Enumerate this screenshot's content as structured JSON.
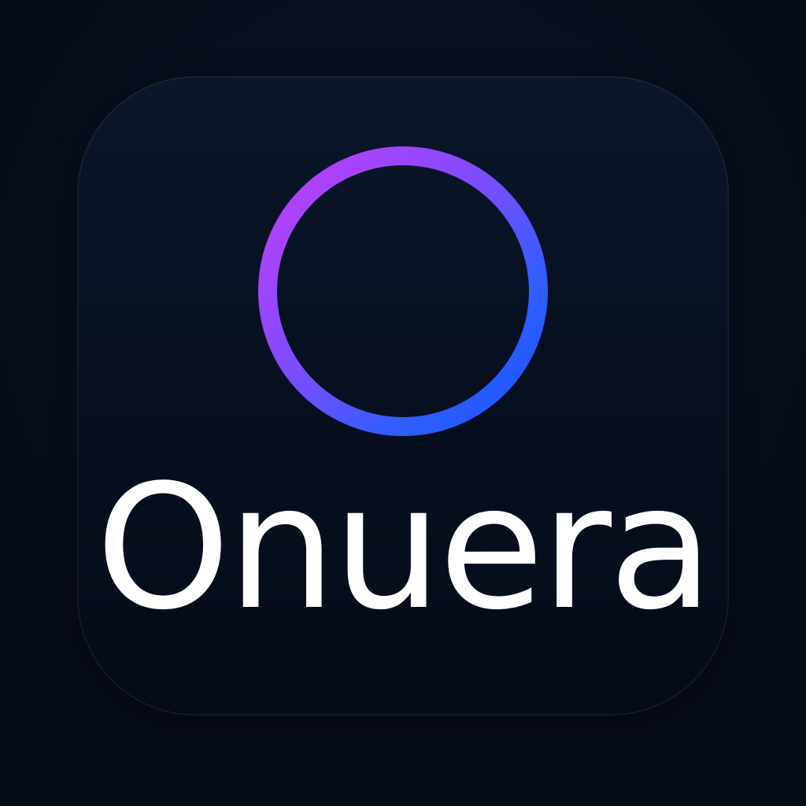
{
  "brand": {
    "name": "Onuera",
    "colors": {
      "background": "#060c19",
      "tile": "#0a1426",
      "wordmark": "#ffffff",
      "ring_gradient_start": "#b347f5",
      "ring_gradient_end": "#1a5cff"
    },
    "icon": "ring-icon"
  }
}
